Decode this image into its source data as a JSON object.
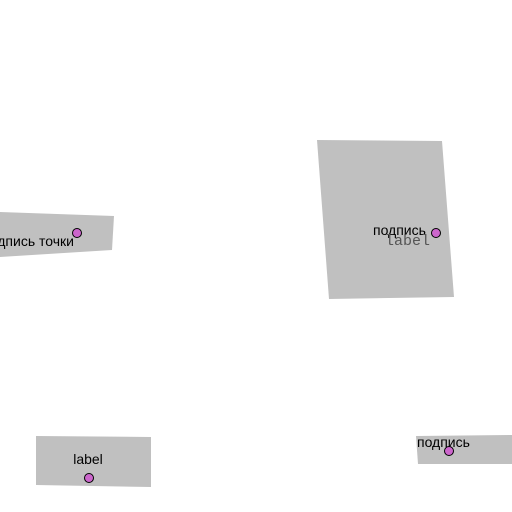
{
  "colors": {
    "background": "#ffffff",
    "polygon_fill": "#c0c0c0",
    "point_fill": "#cc66cc",
    "point_stroke": "#000000",
    "label_text": "#000000",
    "label_text_mono": "#555555"
  },
  "groups": [
    {
      "label": "подпись точки"
    },
    {
      "label": "подпись",
      "secondary_label": "label"
    },
    {
      "label": "label"
    },
    {
      "label": "подпись"
    }
  ]
}
